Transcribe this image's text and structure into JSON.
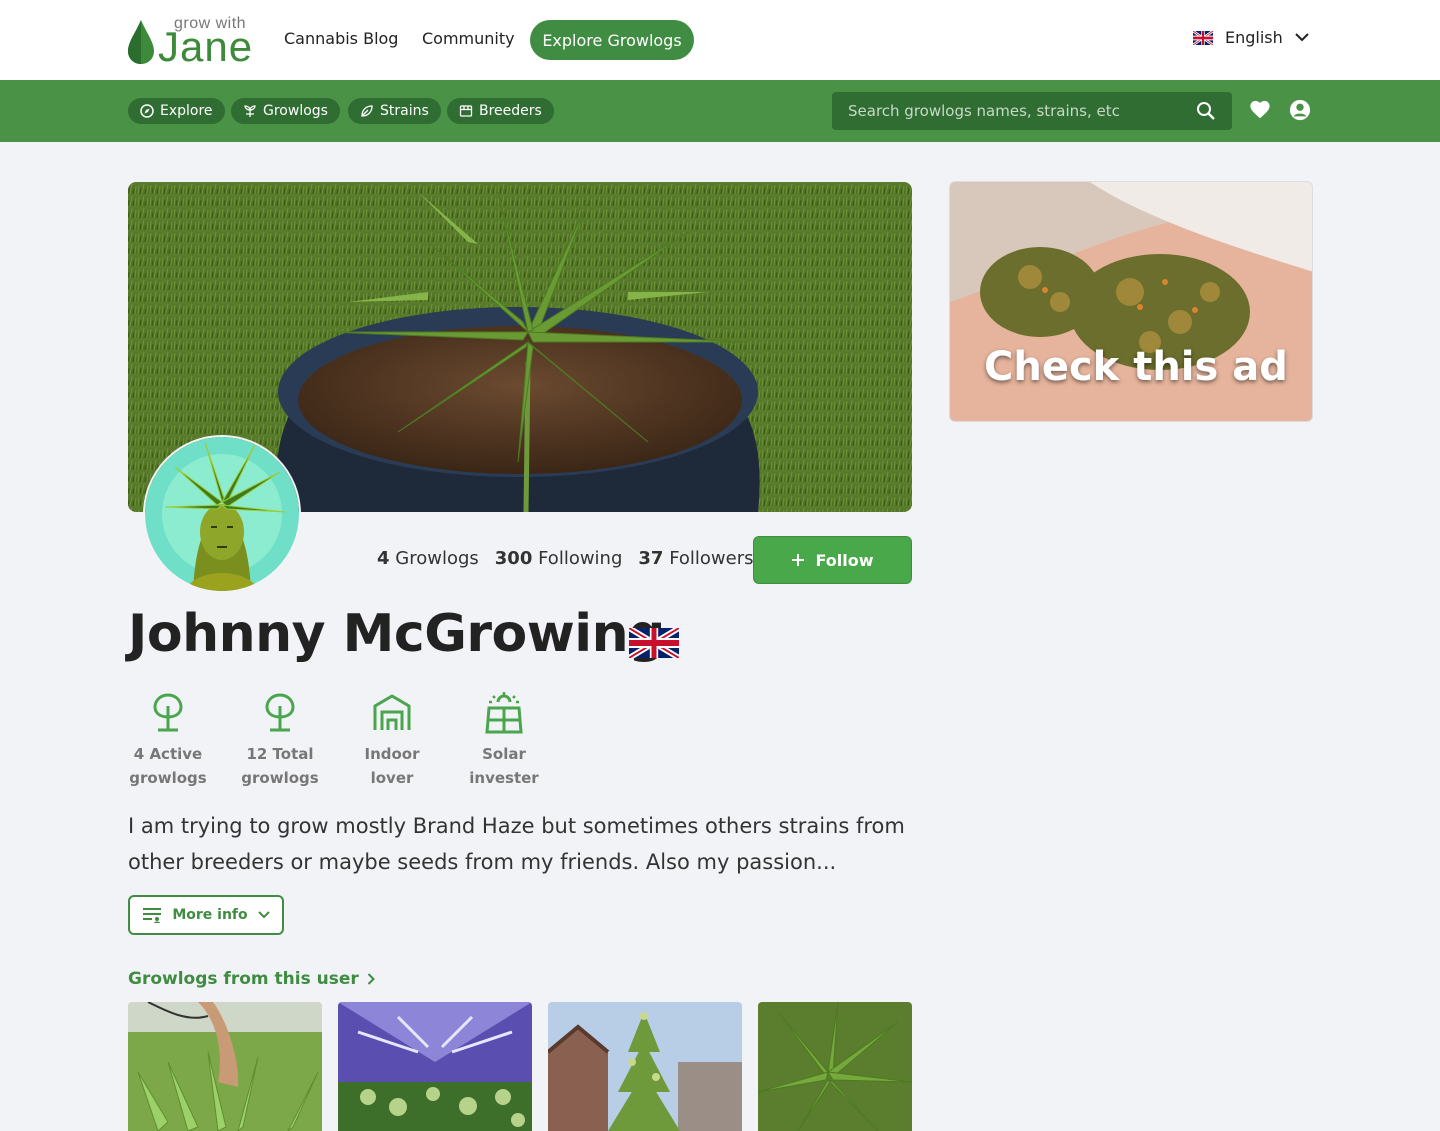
{
  "header": {
    "logo_small": "grow with",
    "logo_big": "Jane",
    "nav": {
      "blog": "Cannabis Blog",
      "community": "Community",
      "explore": "Explore Growlogs"
    },
    "language": "English"
  },
  "subnav": {
    "chips": [
      "Explore",
      "Growlogs",
      "Strains",
      "Breeders"
    ],
    "search_placeholder": "Search growlogs names, strains, etc"
  },
  "profile": {
    "stats": {
      "growlogs_count": "4",
      "growlogs_label": "Growlogs",
      "following_count": "300",
      "following_label": "Following",
      "followers_count": "37",
      "followers_label": "Followers"
    },
    "follow_label": "Follow",
    "name": "Johnny McGrowing",
    "badges": [
      {
        "line1": "4 Active",
        "line2": "growlogs",
        "icon": "tree-icon"
      },
      {
        "line1": "12 Total",
        "line2": "growlogs",
        "icon": "tree-icon"
      },
      {
        "line1": "Indoor",
        "line2": "lover",
        "icon": "garage-icon"
      },
      {
        "line1": "Solar",
        "line2": "invester",
        "icon": "solar-panel-icon"
      }
    ],
    "bio": "I am trying to grow mostly Brand Haze but sometimes others strains from other breeders or maybe seeds from my friends. Also my passion...",
    "more_info_label": "More info",
    "growlogs_section_title": "Growlogs from this user"
  },
  "ad": {
    "text": "Check this ad"
  },
  "colors": {
    "brand_green": "#3f8c42",
    "subbar_green": "#4a9246",
    "chip_green": "#2f6d33",
    "follow_green": "#49a94a"
  }
}
